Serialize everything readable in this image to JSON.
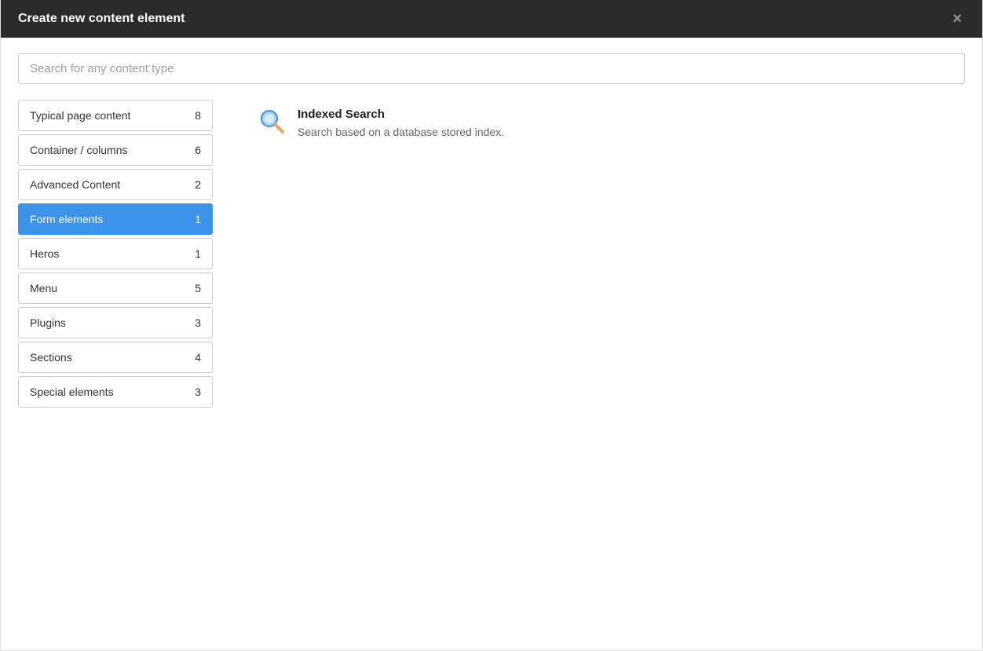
{
  "modal": {
    "title": "Create new content element"
  },
  "search": {
    "placeholder": "Search for any content type",
    "value": ""
  },
  "sidebar": {
    "items": [
      {
        "label": "Typical page content",
        "count": 8,
        "active": false
      },
      {
        "label": "Container / columns",
        "count": 6,
        "active": false
      },
      {
        "label": "Advanced Content",
        "count": 2,
        "active": false
      },
      {
        "label": "Form elements",
        "count": 1,
        "active": true
      },
      {
        "label": "Heros",
        "count": 1,
        "active": false
      },
      {
        "label": "Menu",
        "count": 5,
        "active": false
      },
      {
        "label": "Plugins",
        "count": 3,
        "active": false
      },
      {
        "label": "Sections",
        "count": 4,
        "active": false
      },
      {
        "label": "Special elements",
        "count": 3,
        "active": false
      }
    ]
  },
  "main": {
    "items": [
      {
        "icon": "search-icon",
        "title": "Indexed Search",
        "description": "Search based on a database stored index."
      }
    ]
  }
}
